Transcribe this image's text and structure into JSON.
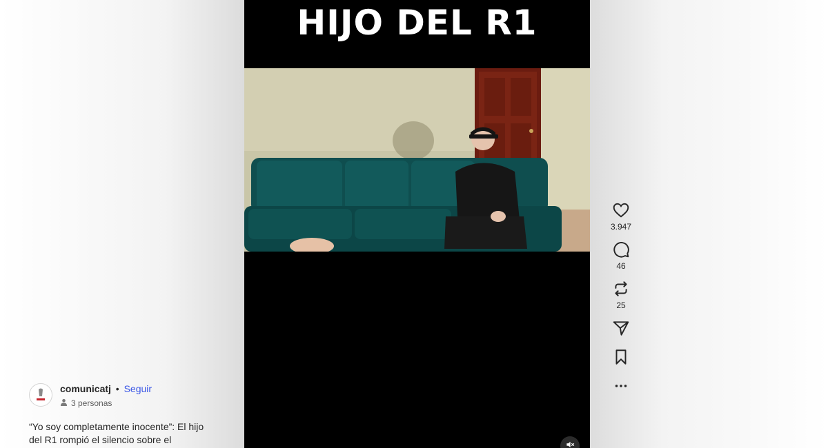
{
  "video": {
    "overlay_title": "HIJO DEL R1",
    "mute_icon": "muted-speaker-icon"
  },
  "actions": {
    "like": {
      "icon": "heart-icon",
      "count": "3.947"
    },
    "comment": {
      "icon": "comment-bubble-icon",
      "count": "46"
    },
    "repost": {
      "icon": "repost-icon",
      "count": "25"
    },
    "share": {
      "icon": "paper-plane-icon"
    },
    "save": {
      "icon": "bookmark-icon"
    },
    "more": {
      "icon": "more-dots-icon"
    }
  },
  "author": {
    "username": "comunicatj",
    "separator": "•",
    "follow_label": "Seguir",
    "audience": "3 personas"
  },
  "caption": {
    "text": "“Yo soy completamente inocente”: El hijo del R1 rompió el silencio sobre el"
  },
  "colors": {
    "follow": "#3a56e6",
    "video_bg": "#000000",
    "text": "#262626"
  }
}
